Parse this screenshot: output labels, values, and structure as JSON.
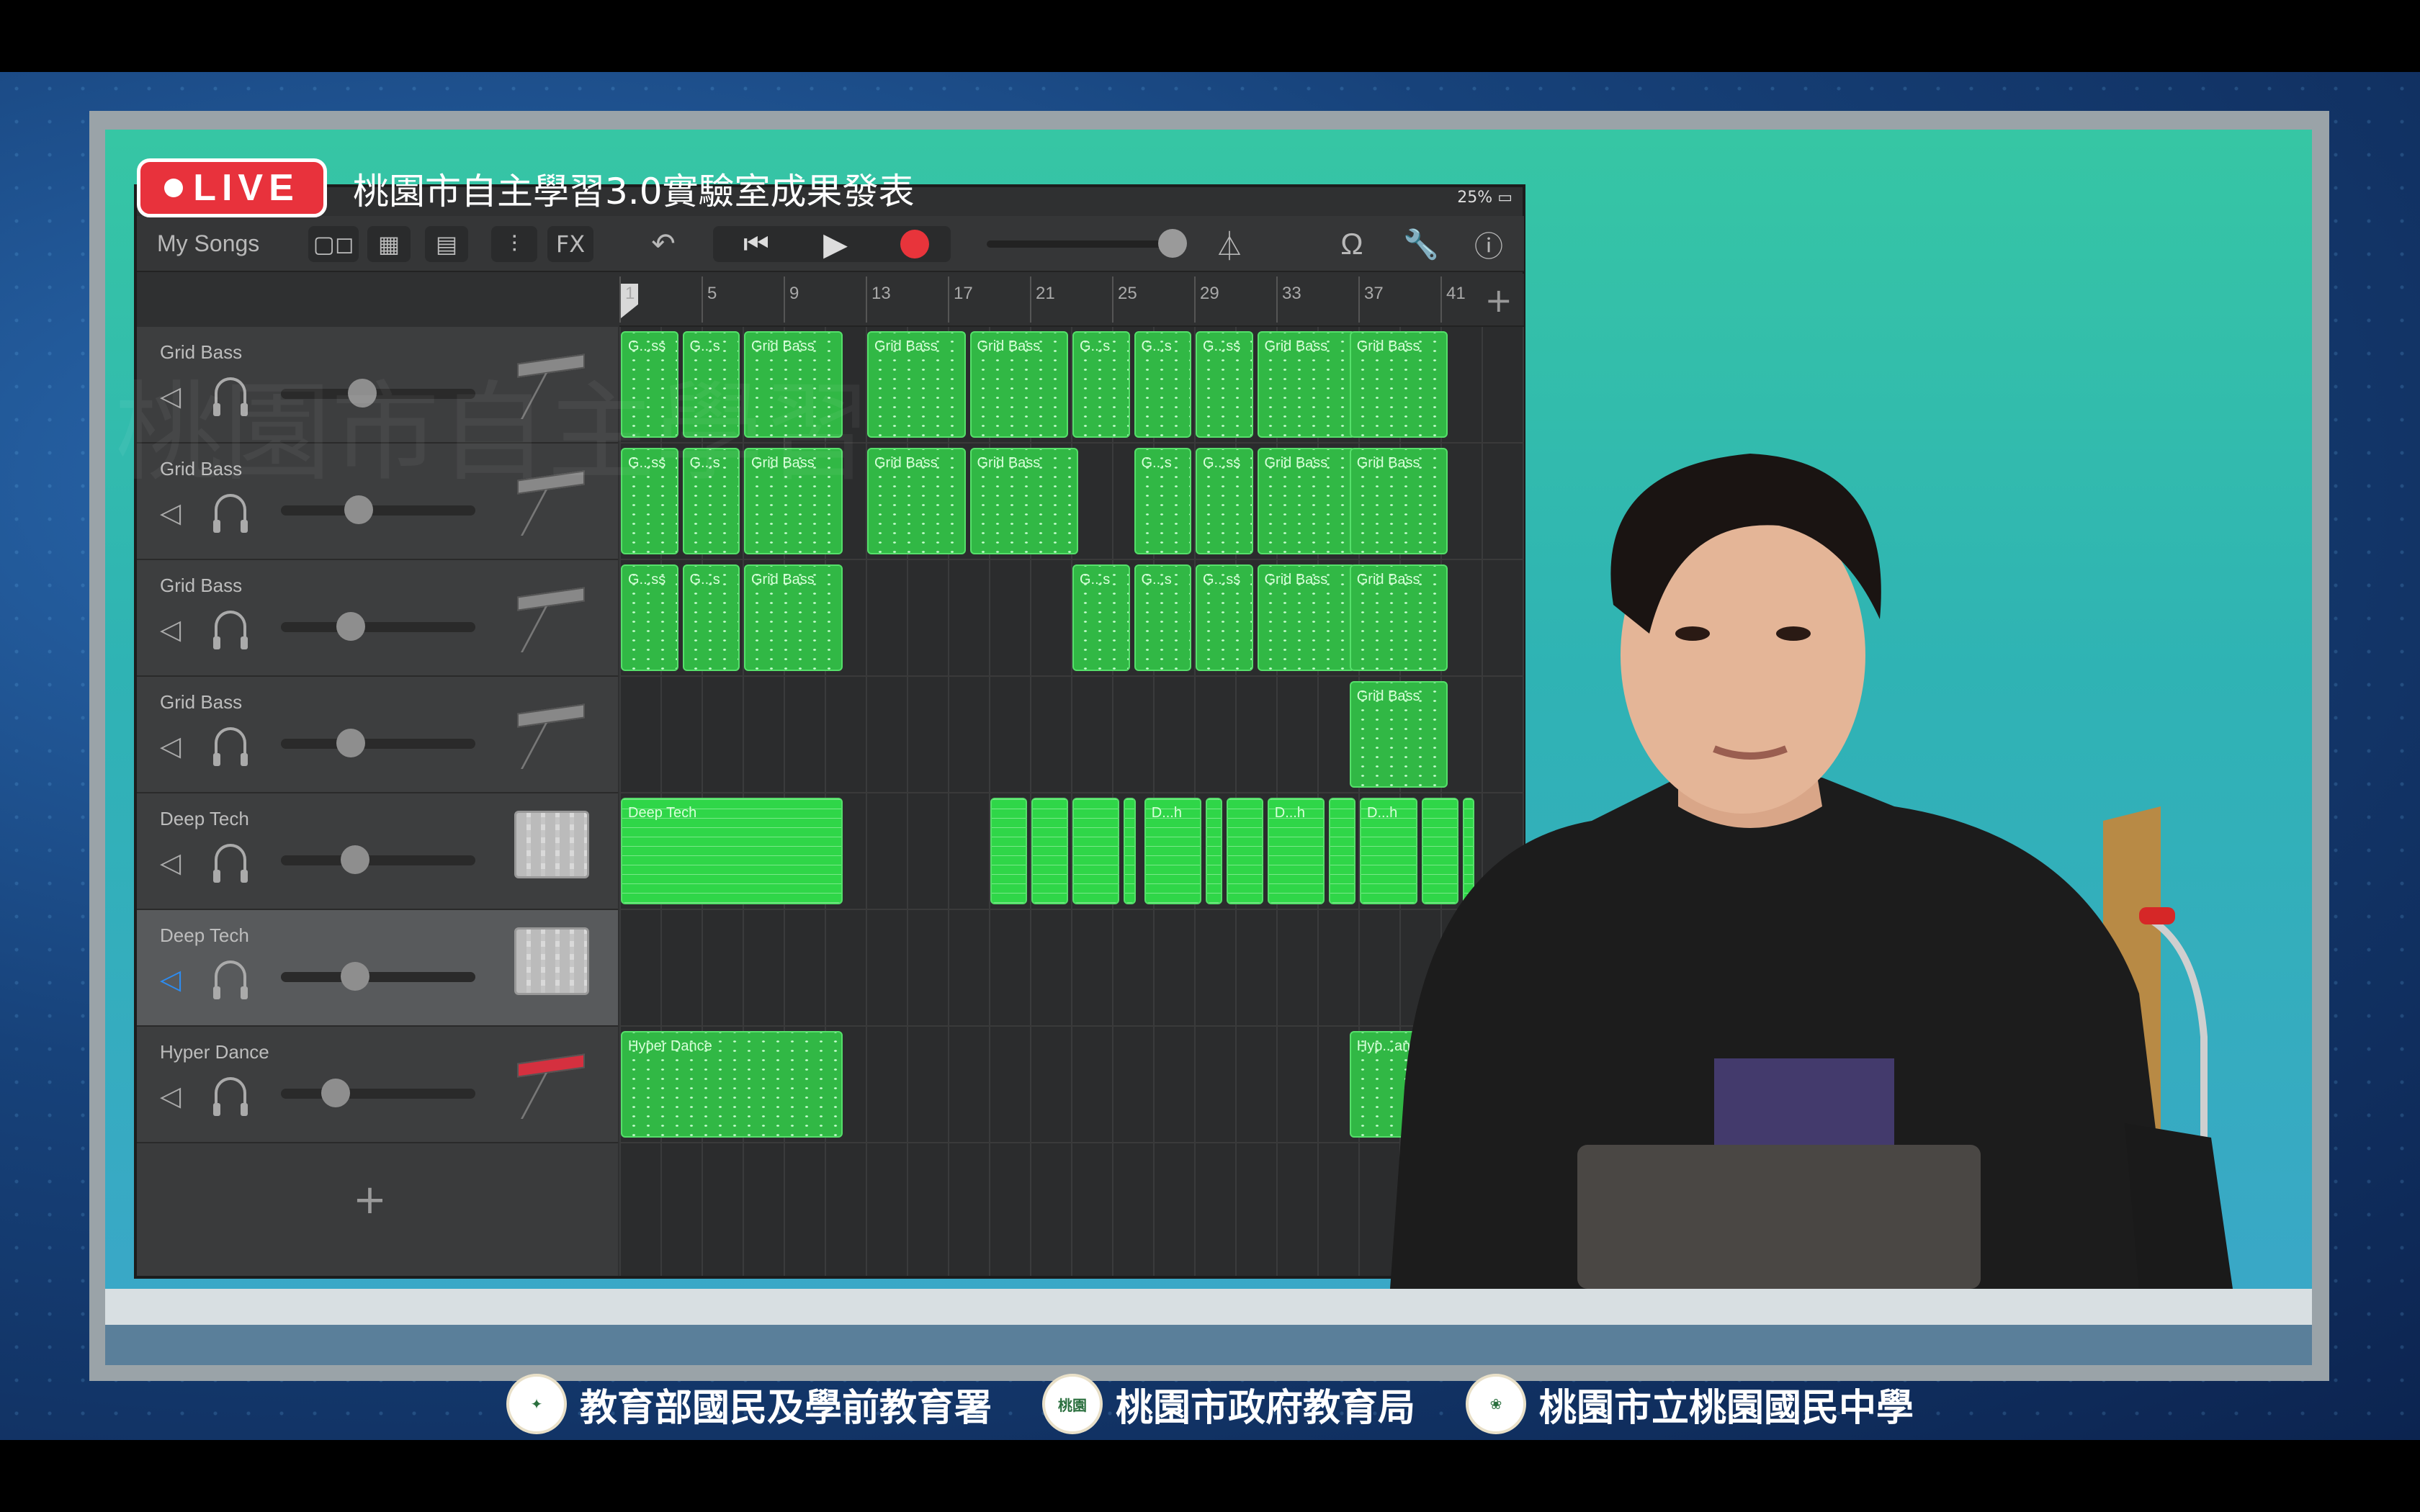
{
  "broadcast": {
    "live_label": "LIVE",
    "event_title": "桃園市自主學習3.0實驗室成果發表",
    "watermark": "桃園市自主學習"
  },
  "ipad_status": {
    "battery": "25%"
  },
  "toolbar": {
    "my_songs": "My Songs",
    "fx": "FX",
    "icons": [
      "view-toggle-icon",
      "tracks-view-icon",
      "grid-view-icon",
      "mixer-icon",
      "fx",
      "undo-icon",
      "rewind-icon",
      "play-icon",
      "record-icon",
      "metronome-icon",
      "loop-icon",
      "settings-wrench-icon",
      "help-icon"
    ]
  },
  "ruler": {
    "bars": [
      "1",
      "5",
      "9",
      "13",
      "17",
      "21",
      "25",
      "29",
      "33",
      "37",
      "41"
    ]
  },
  "tracks": [
    {
      "name": "Grid Bass",
      "muted": false,
      "volume": 0.42,
      "instrument": "keyboard"
    },
    {
      "name": "Grid Bass",
      "muted": false,
      "volume": 0.4,
      "instrument": "keyboard"
    },
    {
      "name": "Grid Bass",
      "muted": false,
      "volume": 0.36,
      "instrument": "keyboard"
    },
    {
      "name": "Grid Bass",
      "muted": false,
      "volume": 0.36,
      "instrument": "keyboard"
    },
    {
      "name": "Deep Tech",
      "muted": false,
      "volume": 0.38,
      "instrument": "drum-machine"
    },
    {
      "name": "Deep Tech",
      "muted": true,
      "volume": 0.38,
      "instrument": "drum-machine",
      "selected": true
    },
    {
      "name": "Hyper Dance",
      "muted": false,
      "volume": 0.28,
      "instrument": "keyboard-red"
    }
  ],
  "regions": [
    [
      {
        "label": "G...ss",
        "start": 1,
        "len": 3
      },
      {
        "label": "G...s",
        "start": 4,
        "len": 3
      },
      {
        "label": "Grid Bass",
        "start": 7,
        "len": 5
      },
      {
        "label": "Grid Bass",
        "start": 13,
        "len": 5
      },
      {
        "label": "Grid Bass",
        "start": 18,
        "len": 5
      },
      {
        "label": "G...s",
        "start": 23,
        "len": 3
      },
      {
        "label": "G...s",
        "start": 26,
        "len": 3
      },
      {
        "label": "G...ss",
        "start": 29,
        "len": 3
      },
      {
        "label": "Grid Bass",
        "start": 32,
        "len": 5
      },
      {
        "label": "Grid Bass",
        "start": 36.5,
        "len": 5
      }
    ],
    [
      {
        "label": "G...ss",
        "start": 1,
        "len": 3
      },
      {
        "label": "G...s",
        "start": 4,
        "len": 3
      },
      {
        "label": "Grid Bass",
        "start": 7,
        "len": 5
      },
      {
        "label": "Grid Bass",
        "start": 13,
        "len": 5
      },
      {
        "label": "Grid Bass",
        "start": 18,
        "len": 5.5
      },
      {
        "label": "G...s",
        "start": 26,
        "len": 3
      },
      {
        "label": "G...ss",
        "start": 29,
        "len": 3
      },
      {
        "label": "Grid Bass",
        "start": 32,
        "len": 5
      },
      {
        "label": "Grid Bass",
        "start": 36.5,
        "len": 5
      }
    ],
    [
      {
        "label": "G...ss",
        "start": 1,
        "len": 3
      },
      {
        "label": "G...s",
        "start": 4,
        "len": 3
      },
      {
        "label": "Grid Bass",
        "start": 7,
        "len": 5
      },
      {
        "label": "G...s",
        "start": 23,
        "len": 3
      },
      {
        "label": "G...s",
        "start": 26,
        "len": 3
      },
      {
        "label": "G...ss",
        "start": 29,
        "len": 3
      },
      {
        "label": "Grid Bass",
        "start": 32,
        "len": 5
      },
      {
        "label": "Grid Bass",
        "start": 36.5,
        "len": 5
      }
    ],
    [
      {
        "label": "Grid Bass",
        "start": 36.5,
        "len": 5
      }
    ],
    [
      {
        "label": "Deep Tech",
        "start": 1,
        "len": 11
      },
      {
        "label": "",
        "start": 19,
        "len": 2
      },
      {
        "label": "",
        "start": 21,
        "len": 2
      },
      {
        "label": "",
        "start": 23,
        "len": 2.5
      },
      {
        "label": "",
        "start": 25.5,
        "len": 0.8
      },
      {
        "label": "D...h",
        "start": 26.5,
        "len": 3
      },
      {
        "label": "",
        "start": 29.5,
        "len": 1
      },
      {
        "label": "",
        "start": 30.5,
        "len": 2
      },
      {
        "label": "D...h",
        "start": 32.5,
        "len": 3
      },
      {
        "label": "",
        "start": 35.5,
        "len": 1.5
      },
      {
        "label": "D...h",
        "start": 37,
        "len": 3
      },
      {
        "label": "",
        "start": 40,
        "len": 2
      },
      {
        "label": "",
        "start": 42,
        "len": 0.8
      }
    ],
    [],
    [
      {
        "label": "Hyper Dance",
        "start": 1,
        "len": 11
      },
      {
        "label": "Hyp...ance",
        "start": 36.5,
        "len": 5
      }
    ]
  ],
  "footer": {
    "orgs": [
      "教育部國民及學前教育署",
      "桃園市政府教育局",
      "桃園市立桃園國民中學"
    ],
    "seal_text": "桃園"
  },
  "colors": {
    "region_green": "#31b845",
    "bright_green": "#2fd648",
    "live_red": "#e8323c",
    "record_red": "#e8343b",
    "mute_blue": "#2d8cf0"
  }
}
